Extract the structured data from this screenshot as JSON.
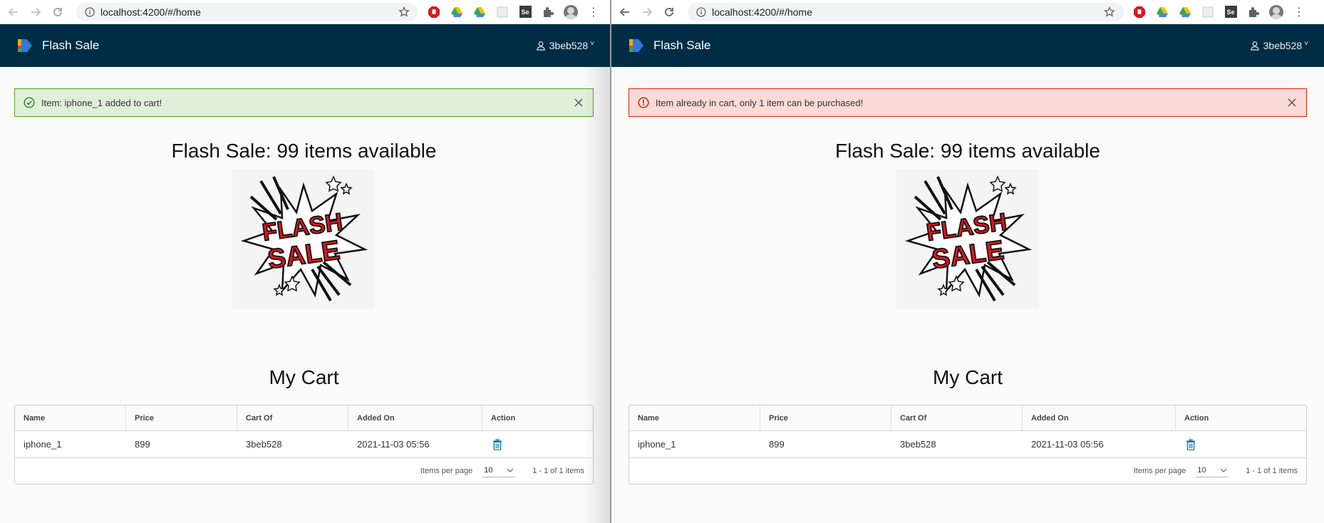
{
  "windows": [
    {
      "id": "left",
      "browser": {
        "url": "localhost:4200/#/home"
      },
      "header": {
        "brand": "Flash Sale",
        "user": "3beb528"
      },
      "alert": {
        "type": "success",
        "message": "Item: iphone_1 added to cart!"
      },
      "headline": "Flash Sale: 99 items available",
      "cart": {
        "title": "My Cart",
        "columns": [
          "Name",
          "Price",
          "Cart Of",
          "Added On",
          "Action"
        ],
        "rows": [
          {
            "name": "iphone_1",
            "price": "899",
            "cart_of": "3beb528",
            "added_on": "2021-11-03 05:56"
          }
        ],
        "footer": {
          "items_per_page_label": "Items per page",
          "items_per_page": "10",
          "range": "1 - 1 of 1 items"
        }
      }
    },
    {
      "id": "right",
      "browser": {
        "url": "localhost:4200/#/home"
      },
      "header": {
        "brand": "Flash Sale",
        "user": "3beb528"
      },
      "alert": {
        "type": "danger",
        "message": "Item already in cart, only 1 item can be purchased!"
      },
      "headline": "Flash Sale: 99 items available",
      "cart": {
        "title": "My Cart",
        "columns": [
          "Name",
          "Price",
          "Cart Of",
          "Added On",
          "Action"
        ],
        "rows": [
          {
            "name": "iphone_1",
            "price": "899",
            "cart_of": "3beb528",
            "added_on": "2021-11-03 05:56"
          }
        ],
        "footer": {
          "items_per_page_label": "Items per page",
          "items_per_page": "10",
          "range": "1 - 1 of 1 items"
        }
      }
    }
  ],
  "image": {
    "lines": [
      "FLASH",
      "SALE"
    ]
  },
  "icons": {
    "back": "arrow-left-icon",
    "forward": "arrow-right-icon",
    "reload": "reload-icon",
    "info": "info-icon",
    "bookmark": "star-icon",
    "user": "user-icon",
    "success": "check-circle-icon",
    "danger": "exclamation-circle-icon",
    "close": "close-icon",
    "delete": "trash-icon"
  },
  "colors": {
    "header_bg": "#002d45",
    "success_bg": "#dfefd9",
    "success_border": "#5aa220",
    "danger_bg": "#f8dad6",
    "danger_border": "#e12200",
    "action_blue": "#0072a3"
  }
}
